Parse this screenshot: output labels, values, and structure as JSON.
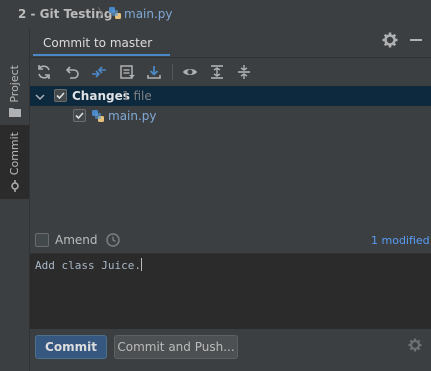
{
  "breadcrumb": {
    "project": "2 - Git Testing",
    "file": "main.py"
  },
  "side_tabs": {
    "project": "Project",
    "commit": "Commit"
  },
  "panel": {
    "title": "Commit to master"
  },
  "changes": {
    "group_label": "Changes",
    "count": "1 file",
    "files": [
      "main.py"
    ]
  },
  "amend": {
    "label": "Amend",
    "modified": "1 modified"
  },
  "message": {
    "text": "Add class Juice."
  },
  "buttons": {
    "commit": "Commit",
    "commit_push": "Commit and Push..."
  },
  "colors": {
    "accent": "#4a88c7",
    "selection": "#0d293e",
    "commit_button": "#365880",
    "file_link": "#7fa9d6"
  },
  "icons": [
    "python-file-icon",
    "gear-icon",
    "minimize-icon",
    "refresh-icon",
    "rollback-icon",
    "show-diff-icon",
    "changelist-icon",
    "update-icon",
    "eye-icon",
    "expand-all-icon",
    "collapse-all-icon",
    "history-icon"
  ]
}
